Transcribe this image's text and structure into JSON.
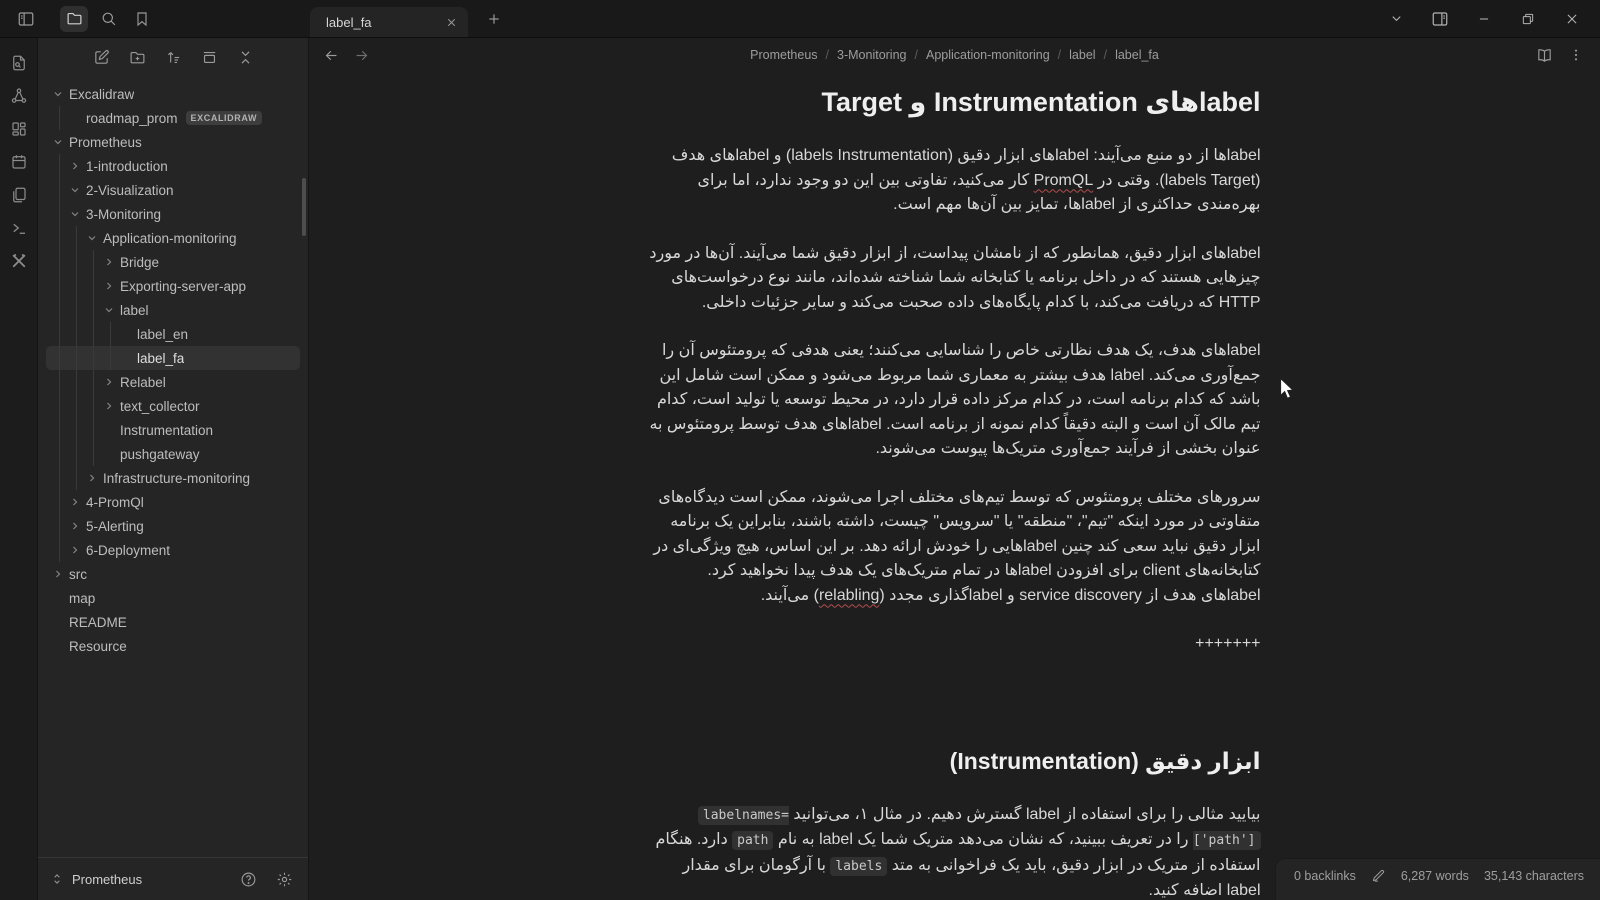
{
  "titlebar": {
    "tab_title": "label_fa"
  },
  "sidebar": {
    "vault_name": "Prometheus",
    "tree": [
      {
        "label": "Excalidraw",
        "level": 0,
        "chevron": "down"
      },
      {
        "label": "roadmap_prom",
        "level": 1,
        "chevron": "none",
        "badge": "EXCALIDRAW"
      },
      {
        "label": "Prometheus",
        "level": 0,
        "chevron": "down"
      },
      {
        "label": "1-introduction",
        "level": 1,
        "chevron": "right"
      },
      {
        "label": "2-Visualization",
        "level": 1,
        "chevron": "down"
      },
      {
        "label": "3-Monitoring",
        "level": 1,
        "chevron": "down"
      },
      {
        "label": "Application-monitoring",
        "level": 2,
        "chevron": "down"
      },
      {
        "label": "Bridge",
        "level": 3,
        "chevron": "right"
      },
      {
        "label": "Exporting-server-app",
        "level": 3,
        "chevron": "right"
      },
      {
        "label": "label",
        "level": 3,
        "chevron": "down"
      },
      {
        "label": "label_en",
        "level": 4,
        "chevron": "none"
      },
      {
        "label": "label_fa",
        "level": 4,
        "chevron": "none",
        "selected": true
      },
      {
        "label": "Relabel",
        "level": 3,
        "chevron": "right"
      },
      {
        "label": "text_collector",
        "level": 3,
        "chevron": "right"
      },
      {
        "label": "Instrumentation",
        "level": 3,
        "chevron": "none"
      },
      {
        "label": "pushgateway",
        "level": 3,
        "chevron": "none"
      },
      {
        "label": "Infrastructure-monitoring",
        "level": 2,
        "chevron": "right"
      },
      {
        "label": "4-PromQl",
        "level": 1,
        "chevron": "right"
      },
      {
        "label": "5-Alerting",
        "level": 1,
        "chevron": "right"
      },
      {
        "label": "6-Deployment",
        "level": 1,
        "chevron": "right"
      },
      {
        "label": "src",
        "level": 0,
        "chevron": "right"
      },
      {
        "label": "map",
        "level": 0,
        "chevron": "none"
      },
      {
        "label": "README",
        "level": 0,
        "chevron": "none"
      },
      {
        "label": "Resource",
        "level": 0,
        "chevron": "none"
      }
    ]
  },
  "editor": {
    "breadcrumbs": [
      "Prometheus",
      "3-Monitoring",
      "Application-monitoring",
      "label",
      "label_fa"
    ],
    "blocks": [
      {
        "type": "h1",
        "text": "label‌های Instrumentation و Target"
      },
      {
        "type": "p",
        "runs": [
          {
            "text": "labelها از دو منبع می‌آیند: labelهای ابزار دقیق (labels Instrumentation) و labelهای هدف (labels Target). وقتی در "
          },
          {
            "text": "PromQL",
            "style": "misspell"
          },
          {
            "text": " کار می‌کنید، تفاوتی بین این دو وجود ندارد، اما برای بهره‌مندی حداکثری از labelها، تمایز بین آن‌ها مهم است."
          }
        ]
      },
      {
        "type": "p",
        "runs": [
          {
            "text": "labelهای ابزار دقیق، همانطور که از نامشان پیداست، از ابزار دقیق شما می‌آیند. آن‌ها در مورد چیزهایی هستند که در داخل برنامه یا کتابخانه شما شناخته شده‌اند، مانند نوع درخواست‌های HTTP که دریافت می‌کند، با کدام پایگاه‌های داده صحبت می‌کند و سایر جزئیات داخلی."
          }
        ]
      },
      {
        "type": "p",
        "runs": [
          {
            "text": "labelهای هدف، یک هدف نظارتی خاص را شناسایی می‌کنند؛ یعنی هدفی که پرومتئوس آن را جمع‌آوری می‌کند. label هدف بیشتر به معماری شما مربوط می‌شود و ممکن است شامل این باشد که کدام برنامه است، در کدام مرکز داده قرار دارد، در محیط توسعه یا تولید است، کدام تیم مالک آن است و البته دقیقاً کدام نمونه از برنامه است. labelهای هدف توسط پرومتئوس به عنوان بخشی از فرآیند جمع‌آوری متریک‌ها پیوست می‌شوند."
          }
        ]
      },
      {
        "type": "p",
        "runs": [
          {
            "text": "سرورهای مختلف پرومتئوس که توسط تیم‌های مختلف اجرا می‌شوند، ممکن است دیدگاه‌های متفاوتی در مورد اینکه \"تیم\"، \"منطقه\" یا \"سرویس\" چیست، داشته باشند، بنابراین یک برنامه ابزار دقیق نباید سعی کند چنین labelهایی را خودش ارائه دهد. بر این اساس، هیچ ویژگی‌ای در کتابخانه‌های client برای افزودن labelها در تمام متریک‌های یک هدف پیدا نخواهید کرد. labelهای هدف از service discovery و labelگذاری مجدد ("
          },
          {
            "text": "relabling",
            "style": "misspell"
          },
          {
            "text": ") می‌آیند."
          }
        ]
      },
      {
        "type": "p",
        "runs": [
          {
            "text": "+++++++"
          }
        ]
      },
      {
        "type": "h2",
        "cls": "spaced",
        "text": "ابزار دقیق (Instrumentation)"
      },
      {
        "type": "p",
        "runs": [
          {
            "text": "بیایید مثالی را برای استفاده از label گسترش دهیم. در مثال ۱، می‌توانید "
          },
          {
            "text": "labelnames=['path']",
            "style": "code"
          },
          {
            "text": " را در تعریف ببینید، که نشان می‌دهد متریک شما یک label به نام "
          },
          {
            "text": "path",
            "style": "code"
          },
          {
            "text": " دارد. هنگام استفاده از متریک در ابزار دقیق، باید یک فراخوانی به متد "
          },
          {
            "text": "labels",
            "style": "code"
          },
          {
            "text": " با آرگومان برای مقدار label اضافه کنید."
          }
        ]
      }
    ]
  },
  "statusbar": {
    "backlinks": "0 backlinks",
    "words": "6,287 words",
    "characters": "35,143 characters"
  },
  "colors": {
    "spellcheck_underline": "#b34d4d",
    "selection_row": "#323232",
    "editor_background": "#1e1e1e",
    "sidebar_background": "#252525"
  }
}
